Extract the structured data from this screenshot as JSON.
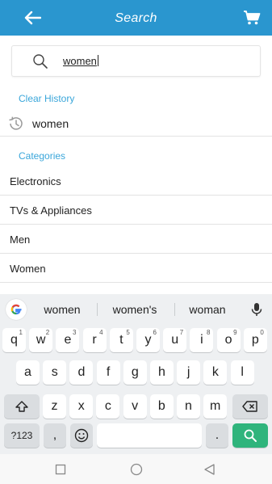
{
  "appbar": {
    "title": "Search",
    "back_icon": "arrow-left-icon",
    "cart_icon": "shopping-cart-icon",
    "color": "#2a96cf"
  },
  "search": {
    "value": "women",
    "icon": "search-icon"
  },
  "history": {
    "header": "Clear History",
    "items": [
      {
        "label": "women",
        "icon": "history-icon"
      }
    ]
  },
  "categories": {
    "header": "Categories",
    "items": [
      "Electronics",
      "TVs & Appliances",
      "Men",
      "Women"
    ]
  },
  "keyboard": {
    "suggestions": [
      "women",
      "women's",
      "woman"
    ],
    "row1": [
      {
        "k": "q",
        "h": "1"
      },
      {
        "k": "w",
        "h": "2"
      },
      {
        "k": "e",
        "h": "3"
      },
      {
        "k": "r",
        "h": "4"
      },
      {
        "k": "t",
        "h": "5"
      },
      {
        "k": "y",
        "h": "6"
      },
      {
        "k": "u",
        "h": "7"
      },
      {
        "k": "i",
        "h": "8"
      },
      {
        "k": "o",
        "h": "9"
      },
      {
        "k": "p",
        "h": "0"
      }
    ],
    "row2": [
      "a",
      "s",
      "d",
      "f",
      "g",
      "h",
      "j",
      "k",
      "l"
    ],
    "row3": [
      "z",
      "x",
      "c",
      "v",
      "b",
      "n",
      "m"
    ],
    "symbols_label": "?123",
    "comma_label": ",",
    "period_label": ".",
    "accent_color": "#2fb47c"
  },
  "accent_text_color": "#3aa6da"
}
